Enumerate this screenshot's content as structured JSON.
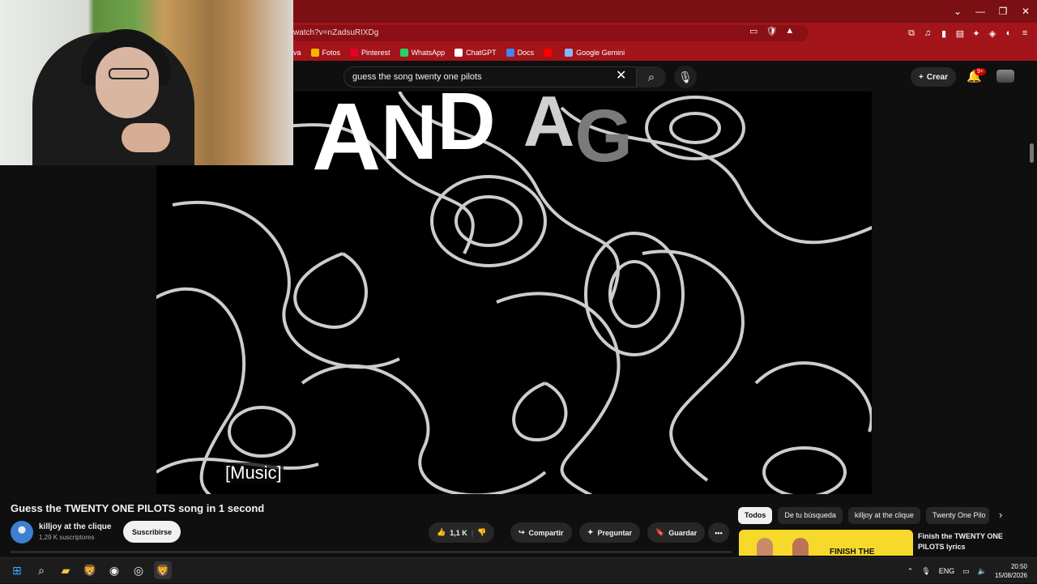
{
  "browser": {
    "url": "watch?v=nZadsuRIXDg",
    "bookmarks": [
      {
        "label": "va",
        "color": "#a3141b"
      },
      {
        "label": "Fotos",
        "color": "#f4b400"
      },
      {
        "label": "Pinterest",
        "color": "#e60023"
      },
      {
        "label": "WhatsApp",
        "color": "#25d366"
      },
      {
        "label": "ChatGPT",
        "color": "#ffffff"
      },
      {
        "label": "Docs",
        "color": "#4285f4"
      },
      {
        "label": "",
        "color": "#ff0000"
      },
      {
        "label": "Google Gemini",
        "color": "#8ab4f8"
      }
    ]
  },
  "header": {
    "search_value": "guess the song twenty one pilots",
    "create_label": "Crear",
    "notifications_badge": "9+"
  },
  "video": {
    "lyric_letters": [
      "A",
      "N",
      "D",
      " ",
      "A",
      "G"
    ],
    "caption": "[Music]"
  },
  "watch": {
    "title": "Guess the TWENTY ONE PILOTS song in 1 second",
    "channel_name": "killjoy at the clique",
    "subscribers": "1,29 K suscriptores",
    "subscribe_label": "Suscribirse",
    "like_count": "1,1 K",
    "share_label": "Compartir",
    "ask_label": "Preguntar",
    "save_label": "Guardar"
  },
  "related": {
    "chips": [
      "Todos",
      "De tu búsqueda",
      "killjoy at the clique",
      "Twenty One Pilo"
    ],
    "first_title": "Finish the TWENTY ONE PILOTS lyrics",
    "first_thumb_text": "FINISH THE"
  },
  "taskbar": {
    "lang": "ENG",
    "time": "20:50",
    "date": "15/08/2026"
  }
}
